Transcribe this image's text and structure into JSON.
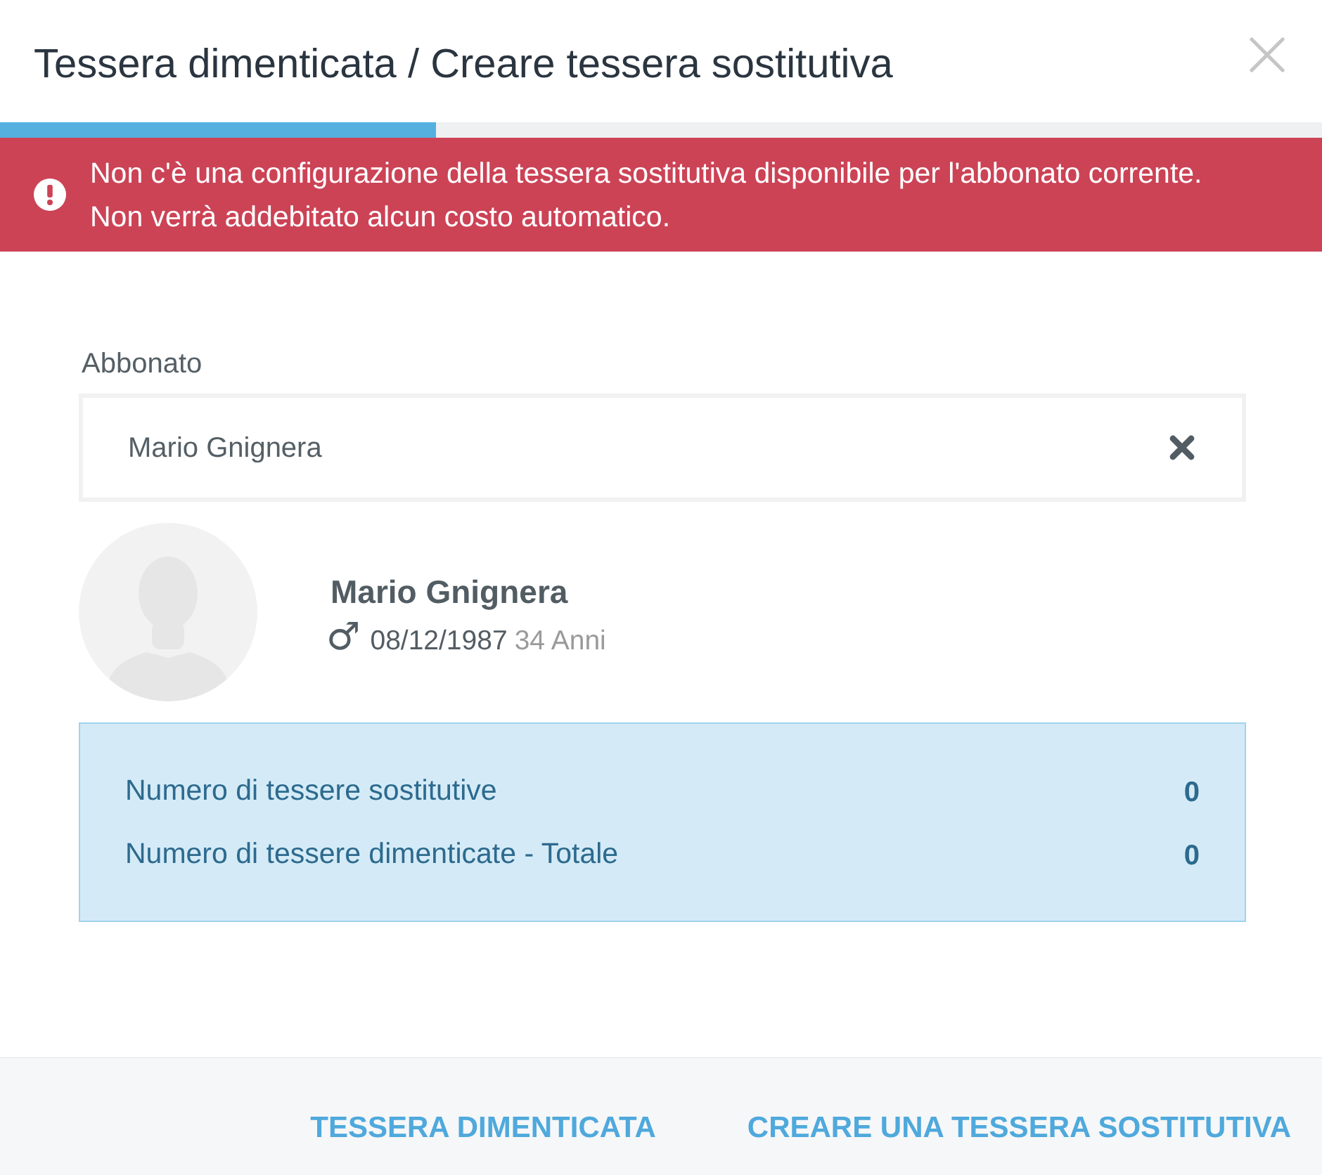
{
  "dialog": {
    "title": "Tessera dimenticata / Creare tessera sostitutiva"
  },
  "progress": {
    "level": 0.33
  },
  "alert": {
    "kind": "error",
    "lines": [
      "Non c'è una configurazione della tessera sostitutiva disponibile per l'abbonato corrente.",
      "Non verrà addebitato alcun costo automatico."
    ]
  },
  "member_field": {
    "label": "Abbonato",
    "value": "Mario Gnignera"
  },
  "member": {
    "name": "Mario Gnignera",
    "gender_symbol": "♂",
    "birth_date": "08/12/1987",
    "age": "34 Anni"
  },
  "stats": [
    {
      "label": "Numero di tessere sostitutive",
      "value": "0"
    },
    {
      "label": "Numero di tessere dimenticate - Totale",
      "value": "0"
    }
  ],
  "actions": [
    {
      "label": "TESSERA DIMENTICATA"
    },
    {
      "label": "CREARE UNA TESSERA SOSTITUTIVA"
    }
  ]
}
